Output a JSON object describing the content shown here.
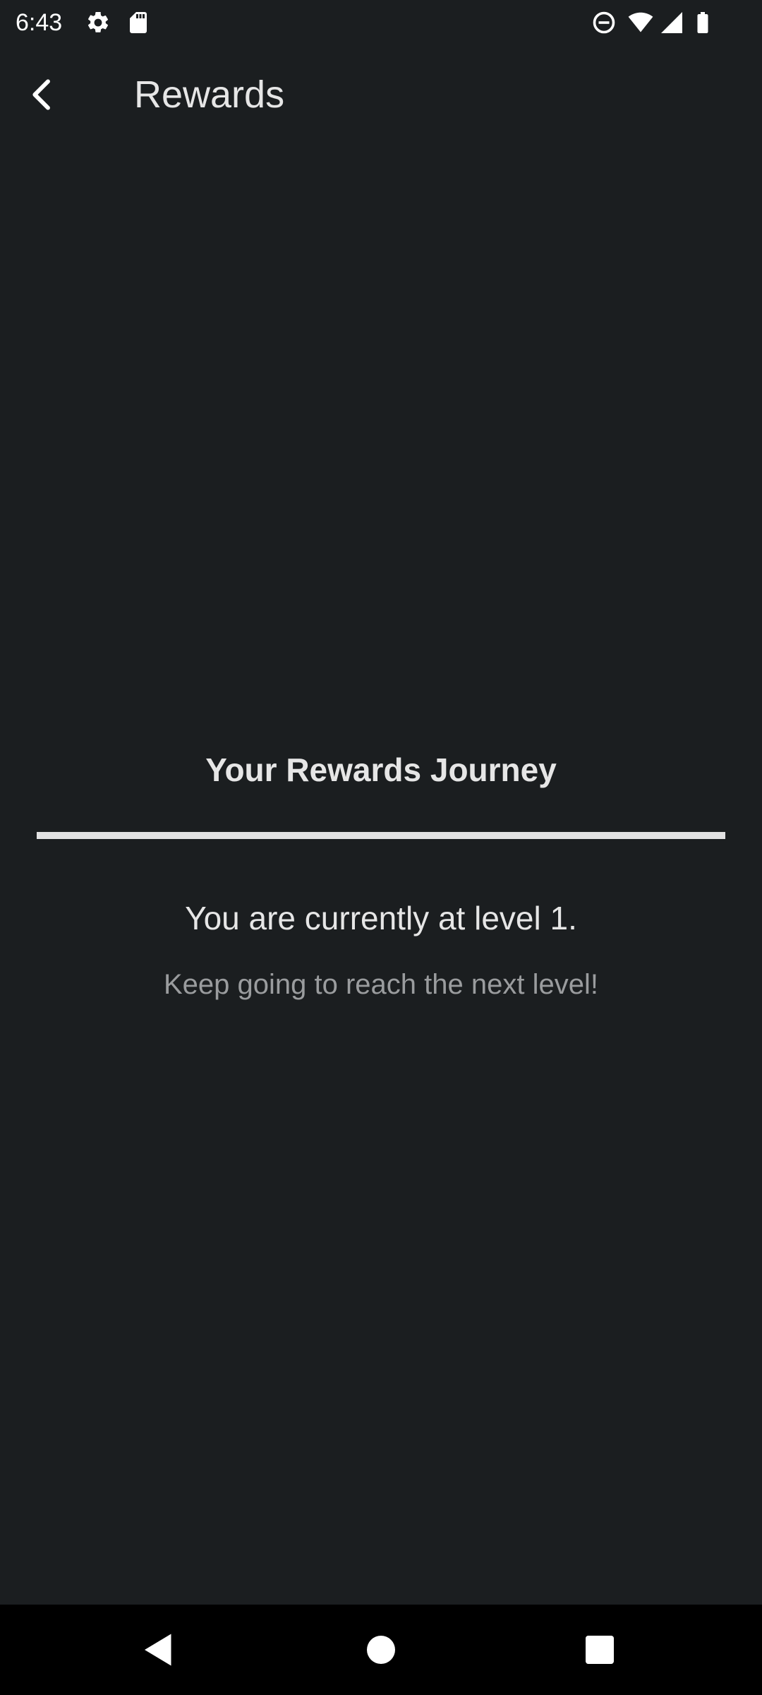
{
  "status_bar": {
    "time": "6:43",
    "left_icons": [
      "gear-icon",
      "sd-card-icon"
    ],
    "right_icons": [
      "do-not-disturb-icon",
      "wifi-icon",
      "cellular-signal-icon",
      "battery-icon"
    ]
  },
  "app_bar": {
    "back_icon": "back-arrow-icon",
    "title": "Rewards"
  },
  "rewards": {
    "journey_title": "Your Rewards Journey",
    "progress": 1.0,
    "level_text": "You are currently at level 1.",
    "hint_text": "Keep going to reach the next level!"
  },
  "nav_bar": {
    "icons": [
      "nav-back-icon",
      "nav-home-icon",
      "nav-recents-icon"
    ]
  },
  "colors": {
    "background": "#1b1e20",
    "text_primary": "#e6e6e6",
    "text_secondary": "#9a9c9e",
    "progress_fill": "#e2e2e2",
    "nav_bar": "#000000"
  }
}
